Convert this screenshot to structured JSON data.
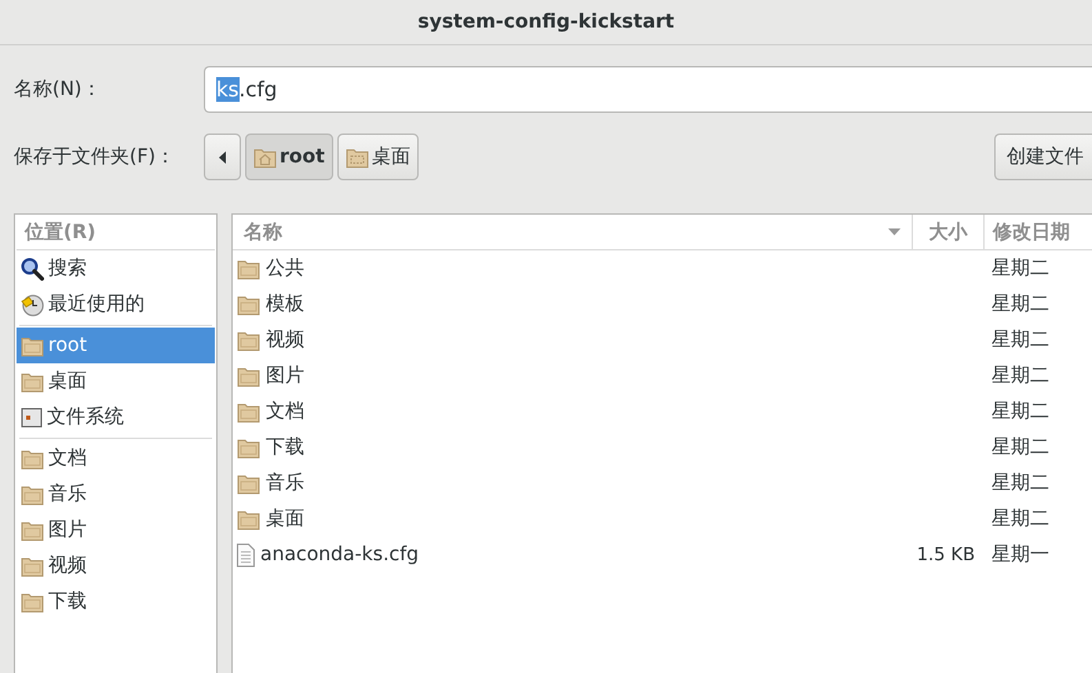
{
  "window": {
    "title": "system-config-kickstart"
  },
  "name_field": {
    "label": "名称(N)：",
    "selected_text": "ks",
    "rest_text": ".cfg"
  },
  "folder_bar": {
    "label": "保存于文件夹(F)：",
    "path": [
      {
        "label": "root",
        "kind": "home",
        "selected": true
      },
      {
        "label": "桌面",
        "kind": "desktop",
        "selected": false
      }
    ],
    "create_button": "创建文件"
  },
  "sidebar": {
    "header": "位置(R)",
    "items": [
      {
        "label": "搜索",
        "kind": "search",
        "selected": false,
        "separator_before": false
      },
      {
        "label": "最近使用的",
        "kind": "recent",
        "selected": false,
        "separator_before": false
      },
      {
        "label": "root",
        "kind": "folder",
        "selected": true,
        "separator_before": true
      },
      {
        "label": "桌面",
        "kind": "folder",
        "selected": false,
        "separator_before": false
      },
      {
        "label": "文件系统",
        "kind": "drive",
        "selected": false,
        "separator_before": false
      },
      {
        "label": "文档",
        "kind": "folder",
        "selected": false,
        "separator_before": true
      },
      {
        "label": "音乐",
        "kind": "folder",
        "selected": false,
        "separator_before": false
      },
      {
        "label": "图片",
        "kind": "folder",
        "selected": false,
        "separator_before": false
      },
      {
        "label": "视频",
        "kind": "folder",
        "selected": false,
        "separator_before": false
      },
      {
        "label": "下载",
        "kind": "folder",
        "selected": false,
        "separator_before": false
      }
    ]
  },
  "table": {
    "columns": [
      "名称",
      "大小",
      "修改日期"
    ],
    "rows": [
      {
        "name": "公共",
        "kind": "folder",
        "size": "",
        "modified": "星期二"
      },
      {
        "name": "模板",
        "kind": "folder",
        "size": "",
        "modified": "星期二"
      },
      {
        "name": "视频",
        "kind": "folder",
        "size": "",
        "modified": "星期二"
      },
      {
        "name": "图片",
        "kind": "folder",
        "size": "",
        "modified": "星期二"
      },
      {
        "name": "文档",
        "kind": "folder",
        "size": "",
        "modified": "星期二"
      },
      {
        "name": "下载",
        "kind": "folder",
        "size": "",
        "modified": "星期二"
      },
      {
        "name": "音乐",
        "kind": "folder",
        "size": "",
        "modified": "星期二"
      },
      {
        "name": "桌面",
        "kind": "folder",
        "size": "",
        "modified": "星期二"
      },
      {
        "name": "anaconda-ks.cfg",
        "kind": "file",
        "size": "1.5 KB",
        "modified": "星期一"
      }
    ]
  }
}
